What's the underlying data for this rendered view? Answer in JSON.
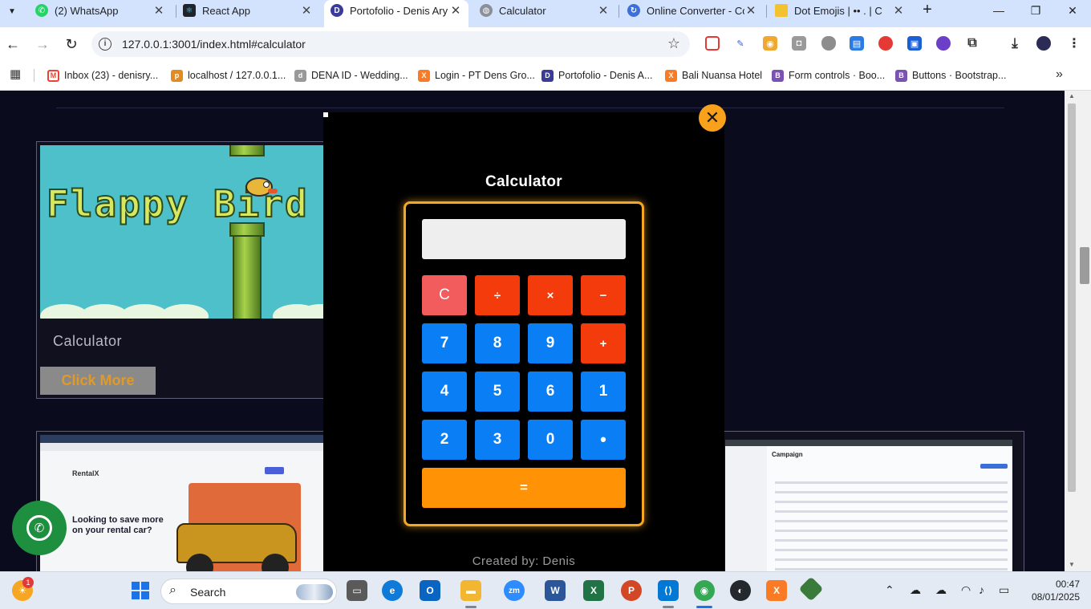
{
  "browser": {
    "tabs": [
      {
        "title": "(2) WhatsApp",
        "icon": "whatsapp-icon",
        "color": "#25d366",
        "active": false
      },
      {
        "title": "React App",
        "icon": "react-icon",
        "color": "#20232a",
        "active": false
      },
      {
        "title": "Portofolio - Denis Ary",
        "icon": "portfolio-d-icon",
        "color": "#3b3b9a",
        "active": true
      },
      {
        "title": "Calculator",
        "icon": "globe-icon",
        "color": "#8a8f98",
        "active": false
      },
      {
        "title": "Online Converter - Co",
        "icon": "converter-icon",
        "color": "#3d6fd9",
        "active": false
      },
      {
        "title": "Dot Emojis | •• . | C",
        "icon": "folder-icon",
        "color": "#f2c230",
        "active": false
      }
    ],
    "new_tab_label": "+",
    "window_controls": {
      "minimize": "—",
      "restore": "❐",
      "close": "✕"
    },
    "url": "127.0.0.1:3001/index.html#calculator",
    "bookmarks": [
      {
        "label": "Inbox (23) - denisry...",
        "icon": "gmail-icon",
        "color": "#ea4335"
      },
      {
        "label": "localhost / 127.0.0.1...",
        "icon": "phpmyadmin-icon",
        "color": "#e28b1f"
      },
      {
        "label": "DENA ID - Wedding...",
        "icon": "dena-icon",
        "color": "#999999"
      },
      {
        "label": "Login - PT Dens Gro...",
        "icon": "xampp-icon",
        "color": "#fb7a24"
      },
      {
        "label": "Portofolio - Denis A...",
        "icon": "portfolio-d-icon",
        "color": "#3b3b9a"
      },
      {
        "label": "Bali Nuansa Hotel",
        "icon": "xampp-icon",
        "color": "#fb7a24"
      },
      {
        "label": "Form controls · Boo...",
        "icon": "bootstrap-icon",
        "color": "#7952b3"
      },
      {
        "label": "Buttons · Bootstrap...",
        "icon": "bootstrap-icon",
        "color": "#7952b3"
      }
    ]
  },
  "page": {
    "project_card": {
      "title": "Calculator",
      "button_label": "Click More",
      "thumbnail_logo": "Flappy Bird"
    },
    "second_card": {
      "thumbnail_brand": "RentalX",
      "thumbnail_heading": "Looking to save more on your rental car?"
    },
    "third_card": {
      "thumbnail_heading": "Campaign"
    }
  },
  "calculator_modal": {
    "title": "Calculator",
    "display_value": "",
    "close_symbol": "✕",
    "keys": [
      {
        "label": "C",
        "kind": "clear"
      },
      {
        "label": "÷",
        "kind": "op"
      },
      {
        "label": "×",
        "kind": "op"
      },
      {
        "label": "−",
        "kind": "op"
      },
      {
        "label": "7",
        "kind": "num"
      },
      {
        "label": "8",
        "kind": "num"
      },
      {
        "label": "9",
        "kind": "num"
      },
      {
        "label": "+",
        "kind": "op"
      },
      {
        "label": "4",
        "kind": "num"
      },
      {
        "label": "5",
        "kind": "num"
      },
      {
        "label": "6",
        "kind": "num"
      },
      {
        "label": "1",
        "kind": "num"
      },
      {
        "label": "2",
        "kind": "num"
      },
      {
        "label": "3",
        "kind": "num"
      },
      {
        "label": "0",
        "kind": "num"
      },
      {
        "label": "•",
        "kind": "num"
      }
    ],
    "equals_label": "=",
    "credits": "Created by: Denis",
    "colors": {
      "frame": "#f5a623",
      "clear": "#f25c5c",
      "op": "#f43b0b",
      "num": "#0a7ff5",
      "equals": "#ff9205",
      "close": "#f9a11b"
    }
  },
  "taskbar": {
    "search_label": "Search",
    "notification_count": "1",
    "time": "00:47",
    "date": "08/01/2025",
    "apps": [
      {
        "name": "windows-start-icon",
        "color": "#1a73e8"
      },
      {
        "name": "task-view-icon",
        "color": "#5a5a5a"
      },
      {
        "name": "edge-icon",
        "color": "#0f7bd8"
      },
      {
        "name": "outlook-icon",
        "color": "#0a64c2"
      },
      {
        "name": "file-explorer-icon",
        "color": "#f2b630"
      },
      {
        "name": "zoom-icon",
        "color": "#2d8cff"
      },
      {
        "name": "word-icon",
        "color": "#2b579a"
      },
      {
        "name": "excel-icon",
        "color": "#217346"
      },
      {
        "name": "powerpoint-icon",
        "color": "#d24726"
      },
      {
        "name": "vscode-icon",
        "color": "#0078d4"
      },
      {
        "name": "chrome-icon",
        "color": "#34a853"
      },
      {
        "name": "github-icon",
        "color": "#24292e"
      },
      {
        "name": "xampp-icon",
        "color": "#fb7a24"
      },
      {
        "name": "git-icon",
        "color": "#3a7a3a"
      }
    ]
  }
}
